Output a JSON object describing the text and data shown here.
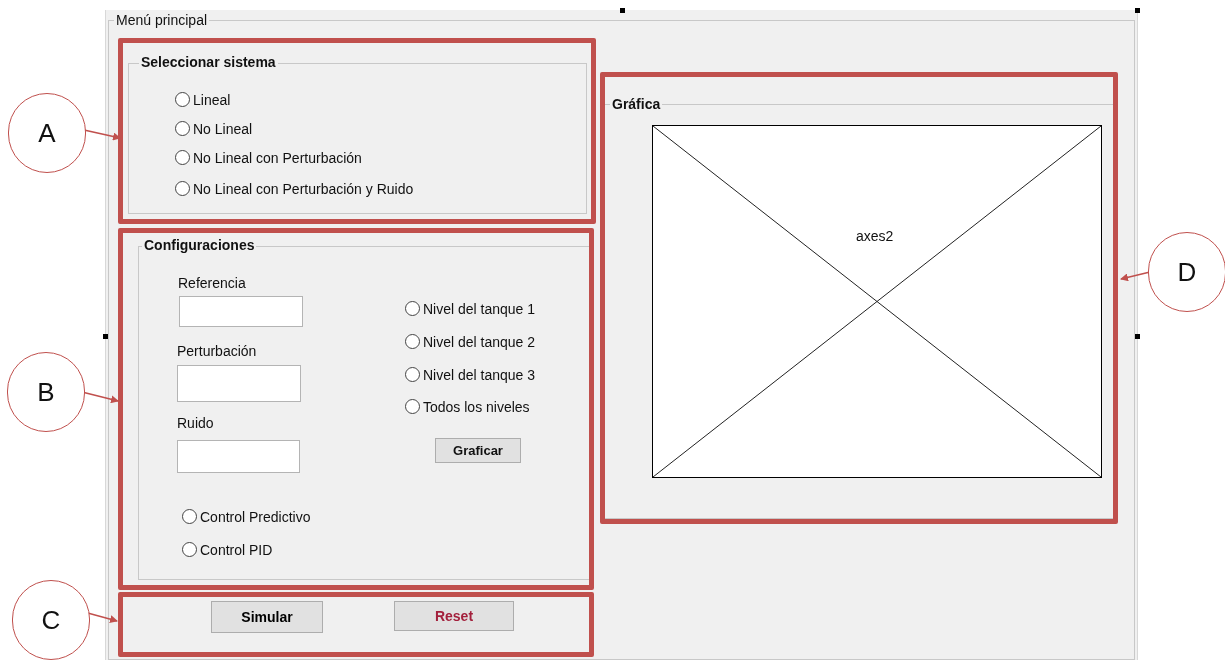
{
  "window": {
    "title": "Menú principal"
  },
  "system_panel": {
    "title": "Seleccionar sistema",
    "options": [
      {
        "label": "Lineal",
        "selected": false
      },
      {
        "label": "No Lineal",
        "selected": false
      },
      {
        "label": "No Lineal con Perturbación",
        "selected": false
      },
      {
        "label": "No Lineal con Perturbación y Ruido",
        "selected": false
      }
    ]
  },
  "config_panel": {
    "title": "Configuraciones",
    "fields": [
      {
        "label": "Referencia"
      },
      {
        "label": "Perturbación"
      },
      {
        "label": "Ruido"
      }
    ],
    "levels": [
      {
        "label": "Nivel del tanque 1",
        "selected": false
      },
      {
        "label": "Nivel del tanque 2",
        "selected": false
      },
      {
        "label": "Nivel del tanque 3",
        "selected": false
      },
      {
        "label": "Todos los niveles",
        "selected": false
      }
    ],
    "graph_button": "Graficar",
    "controls": [
      {
        "label": "Control Predictivo",
        "selected": false
      },
      {
        "label": "Control PID",
        "selected": false
      }
    ]
  },
  "actions": [
    {
      "label": "Simular",
      "color": "#000000"
    },
    {
      "label": "Reset",
      "color": "#a3203c"
    }
  ],
  "graph_panel": {
    "title": "Gráfica",
    "axes_label": "axes2"
  },
  "annotations": [
    {
      "letter": "A"
    },
    {
      "letter": "B"
    },
    {
      "letter": "C"
    },
    {
      "letter": "D"
    }
  ]
}
